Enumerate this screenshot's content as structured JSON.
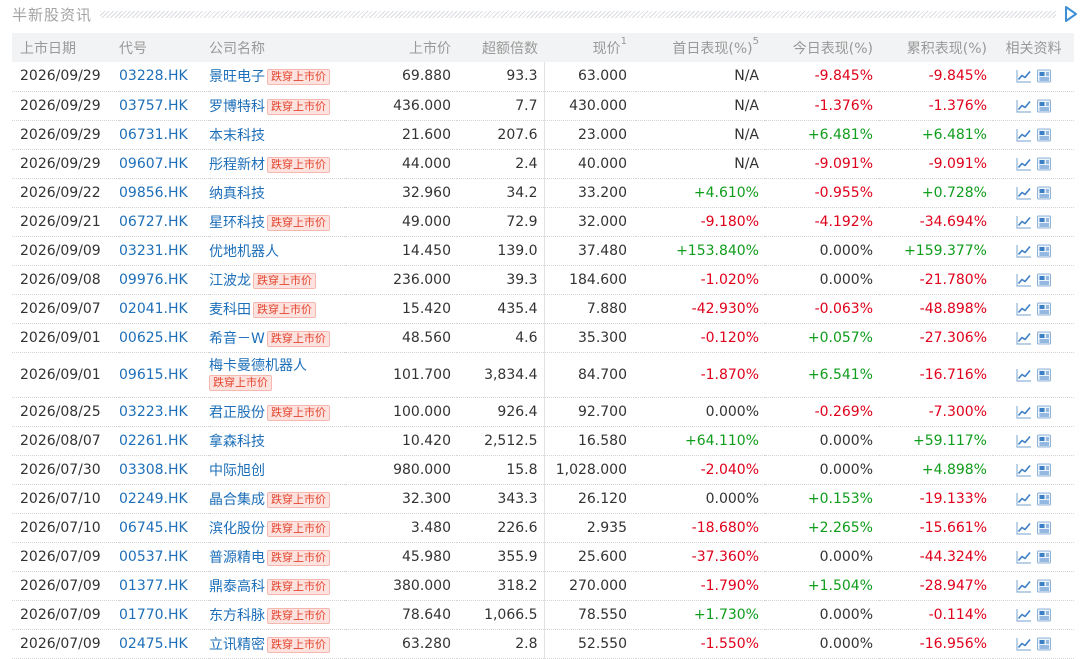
{
  "section": {
    "title": "半新股资讯"
  },
  "columns": {
    "date": "上市日期",
    "code": "代号",
    "name": "公司名称",
    "ipo_price": "上市价",
    "oversub": "超额倍数",
    "price": "现价",
    "price_note": "1",
    "first_day": "首日表现(%)",
    "first_day_note": "5",
    "today": "今日表现(%)",
    "cum": "累积表现(%)",
    "links": "相关资料"
  },
  "badge_text": "跌穿上市价",
  "colors": {
    "up": "#0f9d1c",
    "down": "#e0001b",
    "link": "#1e6fb9",
    "badge": "#e2442f"
  },
  "icons": {
    "more": "play-triangle-icon",
    "chart": "line-chart-icon",
    "news": "document-icon"
  },
  "rows": [
    {
      "date": "2026/09/29",
      "code": "03228.HK",
      "name": "景旺电子",
      "broke": true,
      "ipo_price": "69.880",
      "oversub": "93.3",
      "price": "63.000",
      "first_day": "N/A",
      "today": "-9.845%",
      "cum": "-9.845%"
    },
    {
      "date": "2026/09/29",
      "code": "03757.HK",
      "name": "罗博特科",
      "broke": true,
      "ipo_price": "436.000",
      "oversub": "7.7",
      "price": "430.000",
      "first_day": "N/A",
      "today": "-1.376%",
      "cum": "-1.376%"
    },
    {
      "date": "2026/09/29",
      "code": "06731.HK",
      "name": "本末科技",
      "broke": false,
      "ipo_price": "21.600",
      "oversub": "207.6",
      "price": "23.000",
      "first_day": "N/A",
      "today": "+6.481%",
      "cum": "+6.481%"
    },
    {
      "date": "2026/09/29",
      "code": "09607.HK",
      "name": "彤程新材",
      "broke": true,
      "ipo_price": "44.000",
      "oversub": "2.4",
      "price": "40.000",
      "first_day": "N/A",
      "today": "-9.091%",
      "cum": "-9.091%"
    },
    {
      "date": "2026/09/22",
      "code": "09856.HK",
      "name": "纳真科技",
      "broke": false,
      "ipo_price": "32.960",
      "oversub": "34.2",
      "price": "33.200",
      "first_day": "+4.610%",
      "today": "-0.955%",
      "cum": "+0.728%"
    },
    {
      "date": "2026/09/21",
      "code": "06727.HK",
      "name": "星环科技",
      "broke": true,
      "ipo_price": "49.000",
      "oversub": "72.9",
      "price": "32.000",
      "first_day": "-9.180%",
      "today": "-4.192%",
      "cum": "-34.694%"
    },
    {
      "date": "2026/09/09",
      "code": "03231.HK",
      "name": "优地机器人",
      "broke": false,
      "ipo_price": "14.450",
      "oversub": "139.0",
      "price": "37.480",
      "first_day": "+153.840%",
      "today": "0.000%",
      "cum": "+159.377%"
    },
    {
      "date": "2026/09/08",
      "code": "09976.HK",
      "name": "江波龙",
      "broke": true,
      "ipo_price": "236.000",
      "oversub": "39.3",
      "price": "184.600",
      "first_day": "-1.020%",
      "today": "0.000%",
      "cum": "-21.780%"
    },
    {
      "date": "2026/09/07",
      "code": "02041.HK",
      "name": "麦科田",
      "broke": true,
      "ipo_price": "15.420",
      "oversub": "435.4",
      "price": "7.880",
      "first_day": "-42.930%",
      "today": "-0.063%",
      "cum": "-48.898%"
    },
    {
      "date": "2026/09/01",
      "code": "00625.HK",
      "name": "希音－W",
      "broke": true,
      "ipo_price": "48.560",
      "oversub": "4.6",
      "price": "35.300",
      "first_day": "-0.120%",
      "today": "+0.057%",
      "cum": "-27.306%"
    },
    {
      "date": "2026/09/01",
      "code": "09615.HK",
      "name": "梅卡曼德机器人",
      "broke": true,
      "wrap": true,
      "ipo_price": "101.700",
      "oversub": "3,834.4",
      "price": "84.700",
      "first_day": "-1.870%",
      "today": "+6.541%",
      "cum": "-16.716%"
    },
    {
      "date": "2026/08/25",
      "code": "03223.HK",
      "name": "君正股份",
      "broke": true,
      "ipo_price": "100.000",
      "oversub": "926.4",
      "price": "92.700",
      "first_day": "0.000%",
      "today": "-0.269%",
      "cum": "-7.300%"
    },
    {
      "date": "2026/08/07",
      "code": "02261.HK",
      "name": "拿森科技",
      "broke": false,
      "ipo_price": "10.420",
      "oversub": "2,512.5",
      "price": "16.580",
      "first_day": "+64.110%",
      "today": "0.000%",
      "cum": "+59.117%"
    },
    {
      "date": "2026/07/30",
      "code": "03308.HK",
      "name": "中际旭创",
      "broke": false,
      "ipo_price": "980.000",
      "oversub": "15.8",
      "price": "1,028.000",
      "first_day": "-2.040%",
      "today": "0.000%",
      "cum": "+4.898%"
    },
    {
      "date": "2026/07/10",
      "code": "02249.HK",
      "name": "晶合集成",
      "broke": true,
      "ipo_price": "32.300",
      "oversub": "343.3",
      "price": "26.120",
      "first_day": "0.000%",
      "today": "+0.153%",
      "cum": "-19.133%"
    },
    {
      "date": "2026/07/10",
      "code": "06745.HK",
      "name": "滨化股份",
      "broke": true,
      "ipo_price": "3.480",
      "oversub": "226.6",
      "price": "2.935",
      "first_day": "-18.680%",
      "today": "+2.265%",
      "cum": "-15.661%"
    },
    {
      "date": "2026/07/09",
      "code": "00537.HK",
      "name": "普源精电",
      "broke": true,
      "ipo_price": "45.980",
      "oversub": "355.9",
      "price": "25.600",
      "first_day": "-37.360%",
      "today": "0.000%",
      "cum": "-44.324%"
    },
    {
      "date": "2026/07/09",
      "code": "01377.HK",
      "name": "鼎泰高科",
      "broke": true,
      "ipo_price": "380.000",
      "oversub": "318.2",
      "price": "270.000",
      "first_day": "-1.790%",
      "today": "+1.504%",
      "cum": "-28.947%"
    },
    {
      "date": "2026/07/09",
      "code": "01770.HK",
      "name": "东方科脉",
      "broke": true,
      "ipo_price": "78.640",
      "oversub": "1,066.5",
      "price": "78.550",
      "first_day": "+1.730%",
      "today": "0.000%",
      "cum": "-0.114%"
    },
    {
      "date": "2026/07/09",
      "code": "02475.HK",
      "name": "立讯精密",
      "broke": true,
      "ipo_price": "63.280",
      "oversub": "2.8",
      "price": "52.550",
      "first_day": "-1.550%",
      "today": "0.000%",
      "cum": "-16.956%"
    }
  ]
}
